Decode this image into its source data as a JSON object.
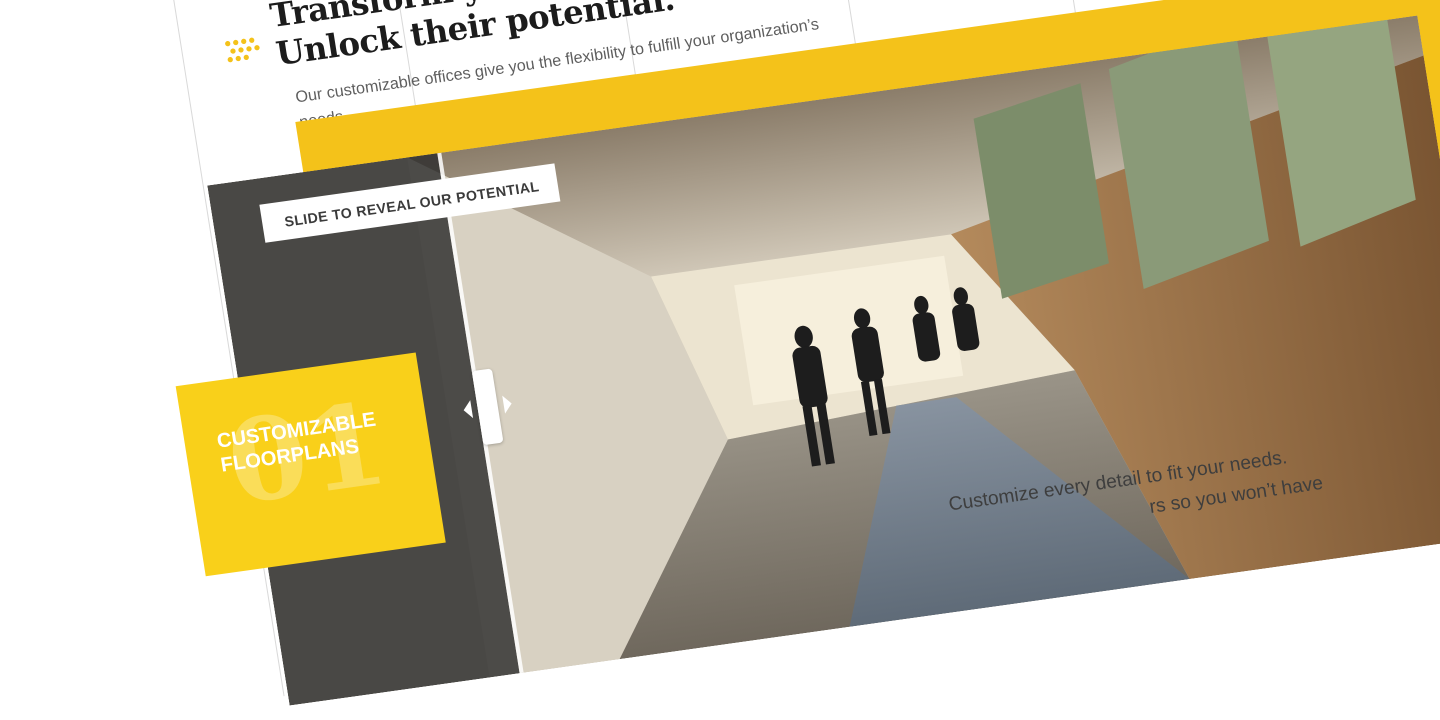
{
  "header": {
    "heading_line1": "Transform your workspac",
    "heading_line2": "Unlock their potential.",
    "subtitle": "Our customizable offices give you the  flexibility to fulfill your organization’s needs."
  },
  "slider": {
    "label": "SLIDE TO REVEAL OUR POTENTIAL"
  },
  "feature": {
    "number": "01",
    "title": "CUSTOMIZABLE FLOORPLANS"
  },
  "body": {
    "line1": "Customize every detail to fit your needs.",
    "line2": "rs so you won’t have"
  },
  "colors": {
    "accent_yellow": "#f4c21a",
    "card_yellow": "#f9d01a",
    "heading_text": "#1c1c1c",
    "body_text": "#5e5e5e"
  },
  "icons": {
    "brand_mark": "yellow-dots-icon",
    "slider_left": "chevron-left-icon",
    "slider_right": "chevron-right-icon"
  }
}
